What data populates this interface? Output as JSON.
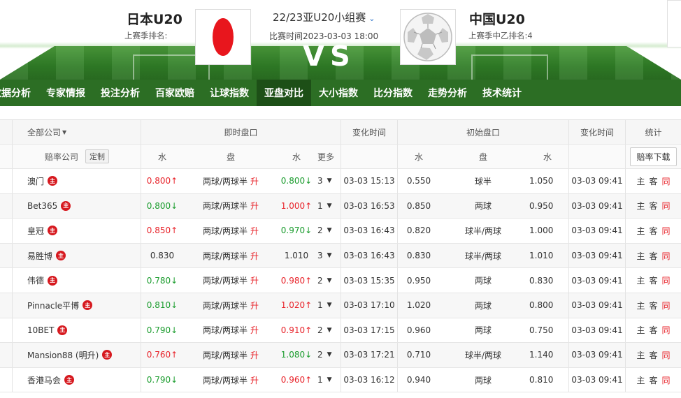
{
  "header": {
    "home_team": "日本U20",
    "home_rank_label": "上赛季排名:",
    "away_team": "中国U20",
    "away_rank_label": "上赛季中乙排名:4",
    "match_title": "22/23亚U20小组赛",
    "match_time": "比赛时间2023-03-03 18:00",
    "vs": "VS"
  },
  "nav": {
    "items": [
      "数据分析",
      "专家情报",
      "投注分析",
      "百家欧赔",
      "让球指数",
      "亚盘对比",
      "大小指数",
      "比分指数",
      "走势分析",
      "技术统计"
    ],
    "active": "亚盘对比"
  },
  "table": {
    "header1": {
      "company_filter": "全部公司",
      "live_group": "即时盘口",
      "change_time": "变化时间",
      "initial_group": "初始盘口",
      "change_time2": "变化时间",
      "stats": "统计"
    },
    "header2": {
      "company": "赔率公司",
      "custom": "定制",
      "water1": "水",
      "pan": "盘",
      "water2": "水",
      "more": "更多",
      "i_water1": "水",
      "i_pan": "盘",
      "i_water2": "水",
      "download": "赔率下载"
    },
    "main_badge": "主",
    "stat_labels": {
      "home": "主",
      "away": "客",
      "same": "同"
    },
    "rows": [
      {
        "company": "澳门",
        "w1": "0.800",
        "w1_dir": "up",
        "pan": "两球/两球半",
        "sheng": "升",
        "w2": "0.800",
        "w2_dir": "down",
        "more": "3",
        "time": "03-03 15:13",
        "iw1": "0.550",
        "ipan": "球半",
        "iw2": "1.050",
        "itime": "03-03 09:41"
      },
      {
        "company": "Bet365",
        "w1": "0.800",
        "w1_dir": "down",
        "pan": "两球/两球半",
        "sheng": "升",
        "w2": "1.000",
        "w2_dir": "up",
        "more": "1",
        "time": "03-03 16:53",
        "iw1": "0.850",
        "ipan": "两球",
        "iw2": "0.950",
        "itime": "03-03 09:41"
      },
      {
        "company": "皇冠",
        "w1": "0.850",
        "w1_dir": "up",
        "pan": "两球/两球半",
        "sheng": "升",
        "w2": "0.970",
        "w2_dir": "down",
        "more": "2",
        "time": "03-03 16:43",
        "iw1": "0.820",
        "ipan": "球半/两球",
        "iw2": "1.000",
        "itime": "03-03 09:41"
      },
      {
        "company": "易胜博",
        "w1": "0.830",
        "w1_dir": "none",
        "pan": "两球/两球半",
        "sheng": "升",
        "w2": "1.010",
        "w2_dir": "none",
        "more": "3",
        "time": "03-03 16:43",
        "iw1": "0.830",
        "ipan": "球半/两球",
        "iw2": "1.010",
        "itime": "03-03 09:41"
      },
      {
        "company": "伟德",
        "w1": "0.780",
        "w1_dir": "down",
        "pan": "两球/两球半",
        "sheng": "升",
        "w2": "0.980",
        "w2_dir": "up",
        "more": "2",
        "time": "03-03 15:35",
        "iw1": "0.950",
        "ipan": "两球",
        "iw2": "0.830",
        "itime": "03-03 09:41"
      },
      {
        "company": "Pinnacle平博",
        "w1": "0.810",
        "w1_dir": "down",
        "pan": "两球/两球半",
        "sheng": "升",
        "w2": "1.020",
        "w2_dir": "up",
        "more": "1",
        "time": "03-03 17:10",
        "iw1": "1.020",
        "ipan": "两球",
        "iw2": "0.800",
        "itime": "03-03 09:41"
      },
      {
        "company": "10BET",
        "w1": "0.790",
        "w1_dir": "down",
        "pan": "两球/两球半",
        "sheng": "升",
        "w2": "0.910",
        "w2_dir": "up",
        "more": "2",
        "time": "03-03 17:15",
        "iw1": "0.960",
        "ipan": "两球",
        "iw2": "0.750",
        "itime": "03-03 09:41"
      },
      {
        "company": "Mansion88 (明升)",
        "w1": "0.760",
        "w1_dir": "up",
        "pan": "两球/两球半",
        "sheng": "升",
        "w2": "1.080",
        "w2_dir": "down",
        "more": "2",
        "time": "03-03 17:21",
        "iw1": "0.710",
        "ipan": "球半/两球",
        "iw2": "1.140",
        "itime": "03-03 09:41"
      },
      {
        "company": "香港马会",
        "w1": "0.790",
        "w1_dir": "down",
        "pan": "两球/两球半",
        "sheng": "升",
        "w2": "0.960",
        "w2_dir": "up",
        "more": "1",
        "time": "03-03 16:12",
        "iw1": "0.940",
        "ipan": "两球",
        "iw2": "0.810",
        "itime": "03-03 09:41"
      }
    ]
  },
  "colors": {
    "nav_bg": "#2c6e24",
    "nav_active": "#1d4f17",
    "up": "#e8232a",
    "down": "#1a9c2d"
  }
}
